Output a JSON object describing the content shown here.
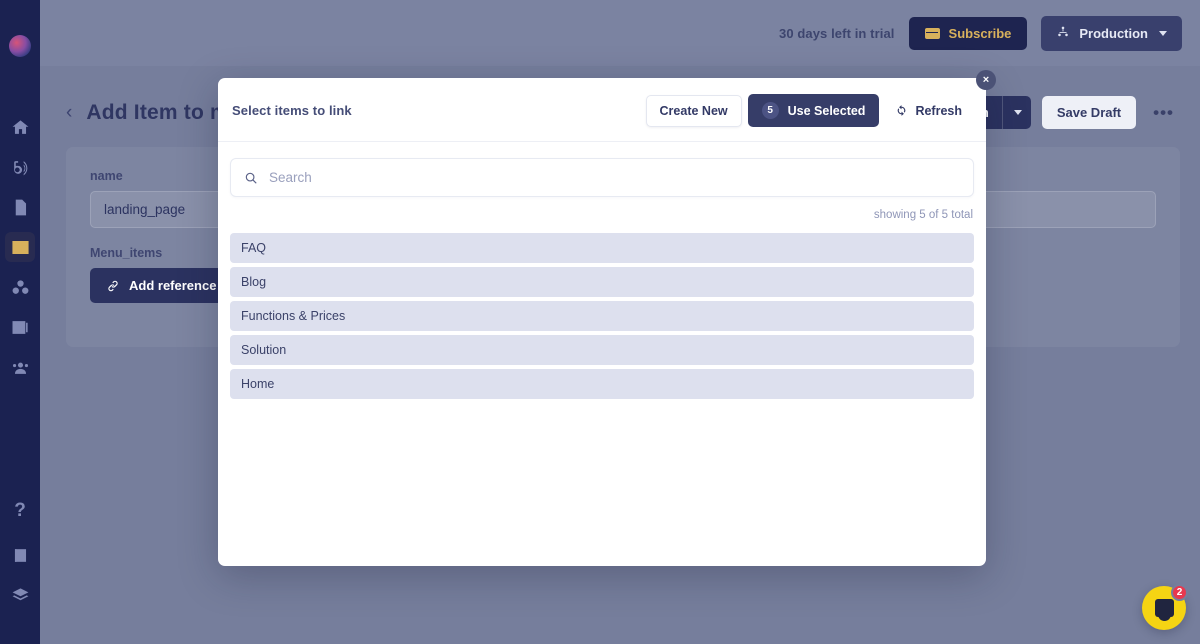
{
  "app": {
    "logo_icon": "avatar-logo",
    "background_color": "#767e9c",
    "rail_color": "#1b2251",
    "accent_gold": "#d8b15c",
    "accent_navy": "#2b3260"
  },
  "sidebar": {
    "items": [
      {
        "icon": "home-icon",
        "name": "home",
        "active": false
      },
      {
        "icon": "broadcast-icon",
        "name": "broadcast",
        "active": false
      },
      {
        "icon": "document-icon",
        "name": "documents",
        "active": false
      },
      {
        "icon": "table-icon",
        "name": "content-models",
        "active": true
      },
      {
        "icon": "cubes-icon",
        "name": "objects",
        "active": false
      },
      {
        "icon": "media-icon",
        "name": "media",
        "active": false
      },
      {
        "icon": "users-icon",
        "name": "users",
        "active": false
      }
    ],
    "bottom_items": [
      {
        "icon": "help-icon",
        "name": "help",
        "label": "?"
      },
      {
        "icon": "book-icon",
        "name": "docs"
      },
      {
        "icon": "layers-icon",
        "name": "layers"
      }
    ]
  },
  "topbar": {
    "trial_text": "30 days left in trial",
    "subscribe_label": "Subscribe",
    "subscribe_icon": "credit-card-icon",
    "environment_label": "Production",
    "environment_icon": "hierarchy-icon",
    "environment_chevron": "chevron-down-icon"
  },
  "page": {
    "back_icon": "chevron-left-icon",
    "title": "Add Item to menu",
    "publish_label": "Publish",
    "publish_chevron": "chevron-down-icon",
    "save_draft_label": "Save Draft",
    "more_label": "•••",
    "fields": [
      {
        "label": "name",
        "value": "landing_page"
      }
    ],
    "reference_field_label": "Menu_items",
    "add_reference_label": "Add reference",
    "add_reference_icon": "link-icon"
  },
  "modal": {
    "title": "Select items to link",
    "close_icon": "close-icon",
    "close_label": "×",
    "create_new_label": "Create New",
    "use_selected_label": "Use Selected",
    "selected_count": "5",
    "refresh_label": "Refresh",
    "refresh_icon": "refresh-icon",
    "search": {
      "icon": "search-icon",
      "value": "",
      "placeholder": "Search"
    },
    "result_count_text": "showing 5 of 5 total",
    "items": [
      {
        "label": "FAQ"
      },
      {
        "label": "Blog"
      },
      {
        "label": "Functions & Prices"
      },
      {
        "label": "Solution"
      },
      {
        "label": "Home"
      }
    ]
  },
  "chat_widget": {
    "icon": "chat-bubble-icon",
    "unread_count": "2",
    "color": "#f5d413",
    "badge_color": "#e8384f"
  }
}
